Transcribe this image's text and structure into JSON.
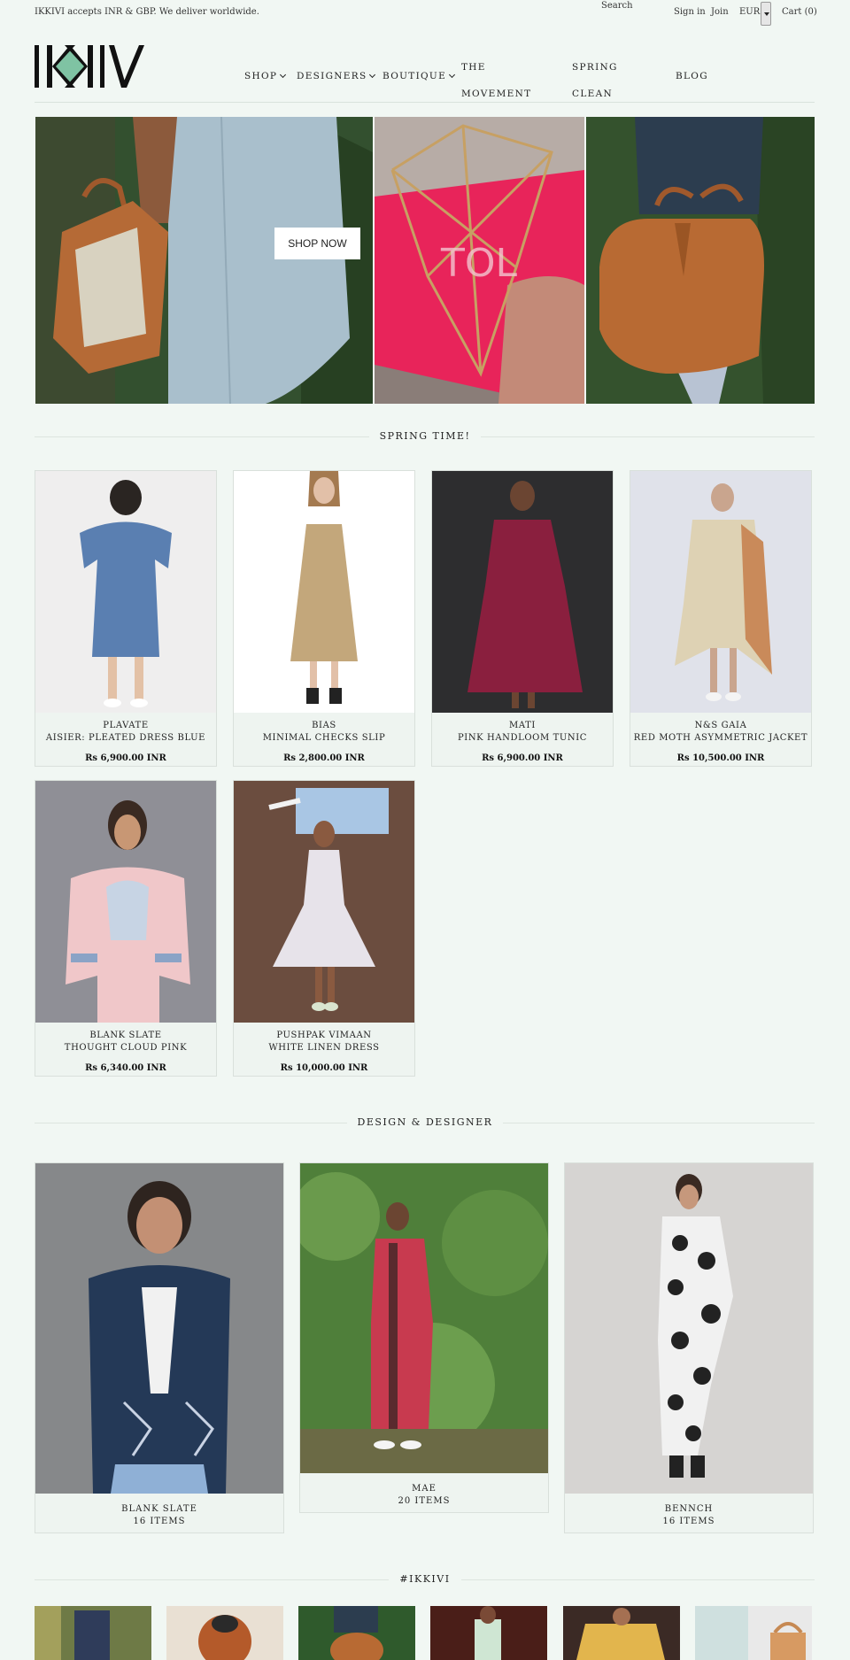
{
  "topbar": {
    "promo": "IKKIVI accepts INR & GBP. We deliver worldwide.",
    "search_label": "Search",
    "sign_in": "Sign in",
    "join": "Join",
    "currency": "EUR",
    "cart": "Cart (0)"
  },
  "nav": {
    "shop": "Shop",
    "designers": "Designers",
    "boutique": "Boutique",
    "movement_1": "The",
    "movement_2": "Movement",
    "spring_1": "Spring",
    "spring_2": "Clean",
    "blog": "Blog"
  },
  "hero": {
    "button": "SHOP NOW",
    "overlay": "TOL"
  },
  "sections": {
    "spring": "SPRING TIME!",
    "design": "DESIGN & DESIGNER",
    "instagram": "#IKKIVI"
  },
  "products": [
    {
      "brand": "PLAVATE",
      "name": "AISIER: PLEATED DRESS BLUE",
      "price": "Rs 6,900.00 INR"
    },
    {
      "brand": "BIAS",
      "name": "MINIMAL CHECKS SLIP",
      "price": "Rs 2,800.00 INR"
    },
    {
      "brand": "MATI",
      "name": "PINK HANDLOOM TUNIC",
      "price": "Rs 6,900.00 INR"
    },
    {
      "brand": "N&S GAIA",
      "name": "RED MOTH ASYMMETRIC JACKET",
      "price": "Rs 10,500.00 INR"
    },
    {
      "brand": "BLANK SLATE",
      "name": "THOUGHT CLOUD PINK",
      "price": "Rs 6,340.00 INR"
    },
    {
      "brand": "PUSHPAK VIMAAN",
      "name": "WHITE LINEN DRESS",
      "price": "Rs 10,000.00 INR"
    }
  ],
  "designers": [
    {
      "name": "BLANK SLATE",
      "count": "16 ITEMS"
    },
    {
      "name": "MAE",
      "count": "20 ITEMS"
    },
    {
      "name": "BENNCH",
      "count": "16 ITEMS"
    }
  ],
  "colors": {
    "background": "#f1f7f3",
    "logo_green": "#7fc3a3",
    "hero_pink": "#e8245a"
  }
}
